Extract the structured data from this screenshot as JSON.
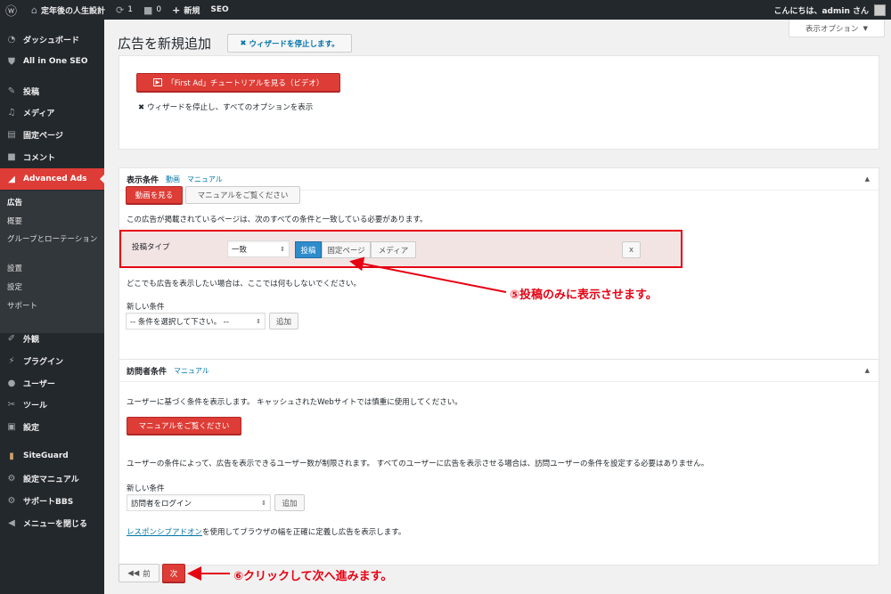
{
  "adminbar": {
    "site_name": "定年後の人生設計",
    "updates_count": "1",
    "comments_count": "0",
    "new_label": "新規",
    "seo_label": "SEO",
    "greeting": "こんにちは、admin さん"
  },
  "sidebar": {
    "items": [
      {
        "label": "ダッシュボード",
        "icon": "dashboard-icon"
      },
      {
        "label": "All in One SEO",
        "icon": "shield-icon"
      },
      {
        "label": "投稿",
        "icon": "pin-icon"
      },
      {
        "label": "メディア",
        "icon": "media-icon"
      },
      {
        "label": "固定ページ",
        "icon": "page-icon"
      },
      {
        "label": "コメント",
        "icon": "comment-icon"
      },
      {
        "label": "Advanced Ads",
        "icon": "ads-icon"
      },
      {
        "label": "外観",
        "icon": "brush-icon"
      },
      {
        "label": "プラグイン",
        "icon": "plugin-icon"
      },
      {
        "label": "ユーザー",
        "icon": "user-icon"
      },
      {
        "label": "ツール",
        "icon": "wrench-icon"
      },
      {
        "label": "設定",
        "icon": "settings-icon"
      },
      {
        "label": "SiteGuard",
        "icon": "siteguard-icon"
      },
      {
        "label": "設定マニュアル",
        "icon": "gear-icon"
      },
      {
        "label": "サポートBBS",
        "icon": "gear-icon"
      },
      {
        "label": "メニューを閉じる",
        "icon": "collapse-icon"
      }
    ],
    "submenu": [
      "広告",
      "概要",
      "グループとローテーション",
      "設置",
      "設定",
      "サポート"
    ]
  },
  "page": {
    "title": "広告を新規追加",
    "stop_wizard_btn": "ウィザードを停止します。",
    "screen_options": "表示オプション"
  },
  "tutorial_box": {
    "video_btn": "「First Ad」チュートリアルを見る（ビデオ）",
    "stop_link": "ウィザードを停止し、すべてのオプションを表示"
  },
  "display_box": {
    "title": "表示条件",
    "link_video": "動画",
    "link_manual": "マニュアル",
    "watch_btn": "動画を見る",
    "manual_btn": "マニュアルをご覧ください",
    "desc": "この広告が掲載されているページは、次のすべての条件と一致している必要があります。",
    "cond_label": "投稿タイプ",
    "cond_operator": "一致",
    "types": [
      "投稿",
      "固定ページ",
      "メディア"
    ],
    "remove_btn": "x",
    "note": "どこでも広告を表示したい場合は、ここでは何もしないでください。",
    "new_cond_label": "新しい条件",
    "new_cond_select": "-- 条件を選択して下さい。 --",
    "add_btn": "追加"
  },
  "visitor_box": {
    "title": "訪問者条件",
    "link_manual": "マニュアル",
    "desc": "ユーザーに基づく条件を表示します。 キャッシュされたWebサイトでは慎重に使用してください。",
    "manual_btn": "マニュアルをご覧ください",
    "note": "ユーザーの条件によって、広告を表示できるユーザー数が制限されます。 すべてのユーザーに広告を表示させる場合は、訪問ユーザーの条件を設定する必要はありません。",
    "new_cond_label": "新しい条件",
    "new_cond_select": "訪問者をログイン",
    "add_btn": "追加",
    "addon_link": "レスポンシブアドオン",
    "addon_text": "を使用してブラウザの幅を正確に定義し広告を表示します。"
  },
  "nav": {
    "prev": "前",
    "next": "次"
  },
  "annotations": {
    "a5": "⑤投稿のみに表示させます。",
    "a6": "⑥クリックして次へ進みます。"
  },
  "colors": {
    "adminbar": "#23282d",
    "accent_red": "#dd3d36",
    "annotation_red": "#e60012",
    "link_blue": "#0073aa",
    "selected_blue": "#2e8ccb"
  }
}
